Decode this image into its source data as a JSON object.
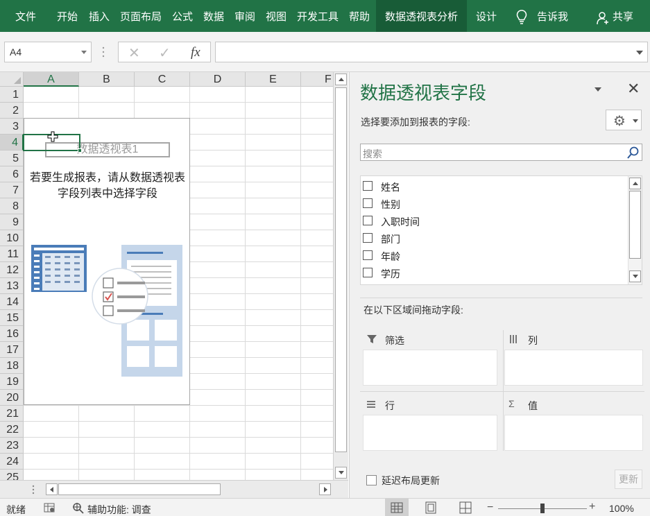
{
  "ribbon": {
    "tabs": [
      "文件",
      "开始",
      "插入",
      "页面布局",
      "公式",
      "数据",
      "审阅",
      "视图",
      "开发工具",
      "帮助",
      "数据透视表分析",
      "设计"
    ],
    "active_tab": "数据透视表分析",
    "tell_me": "告诉我",
    "share": "共享",
    "bg_color": "#217346"
  },
  "formula_bar": {
    "name_box": "A4",
    "cancel_icon": "✕",
    "enter_icon": "✓",
    "fx_label": "fx",
    "formula": ""
  },
  "sheet": {
    "columns": [
      "A",
      "B",
      "C",
      "D",
      "E",
      "F"
    ],
    "rows": [
      "1",
      "2",
      "3",
      "4",
      "5",
      "6",
      "7",
      "8",
      "9",
      "10",
      "11",
      "12",
      "13",
      "14",
      "15",
      "16",
      "17",
      "18",
      "19",
      "20",
      "21",
      "22",
      "23",
      "24",
      "25"
    ],
    "selected_column": "A",
    "selected_row": "4"
  },
  "pivot_placeholder": {
    "name": "数据透视表1",
    "message": "若要生成报表，请从数据透视表字段列表中选择字段"
  },
  "panel": {
    "title": "数据透视表字段",
    "subtitle": "选择要添加到报表的字段:",
    "search_placeholder": "搜索",
    "fields": [
      "姓名",
      "性别",
      "入职时间",
      "部门",
      "年龄",
      "学历"
    ],
    "drag_hint": "在以下区域间拖动字段:",
    "areas": {
      "filter": "筛选",
      "columns": "列",
      "rows": "行",
      "values": "值"
    },
    "defer_label": "延迟布局更新",
    "update_label": "更新",
    "accent": "#217346"
  },
  "status_bar": {
    "ready": "就绪",
    "accessibility": "辅助功能: 调查",
    "zoom_minus": "−",
    "zoom_plus": "+",
    "zoom": "100%"
  }
}
